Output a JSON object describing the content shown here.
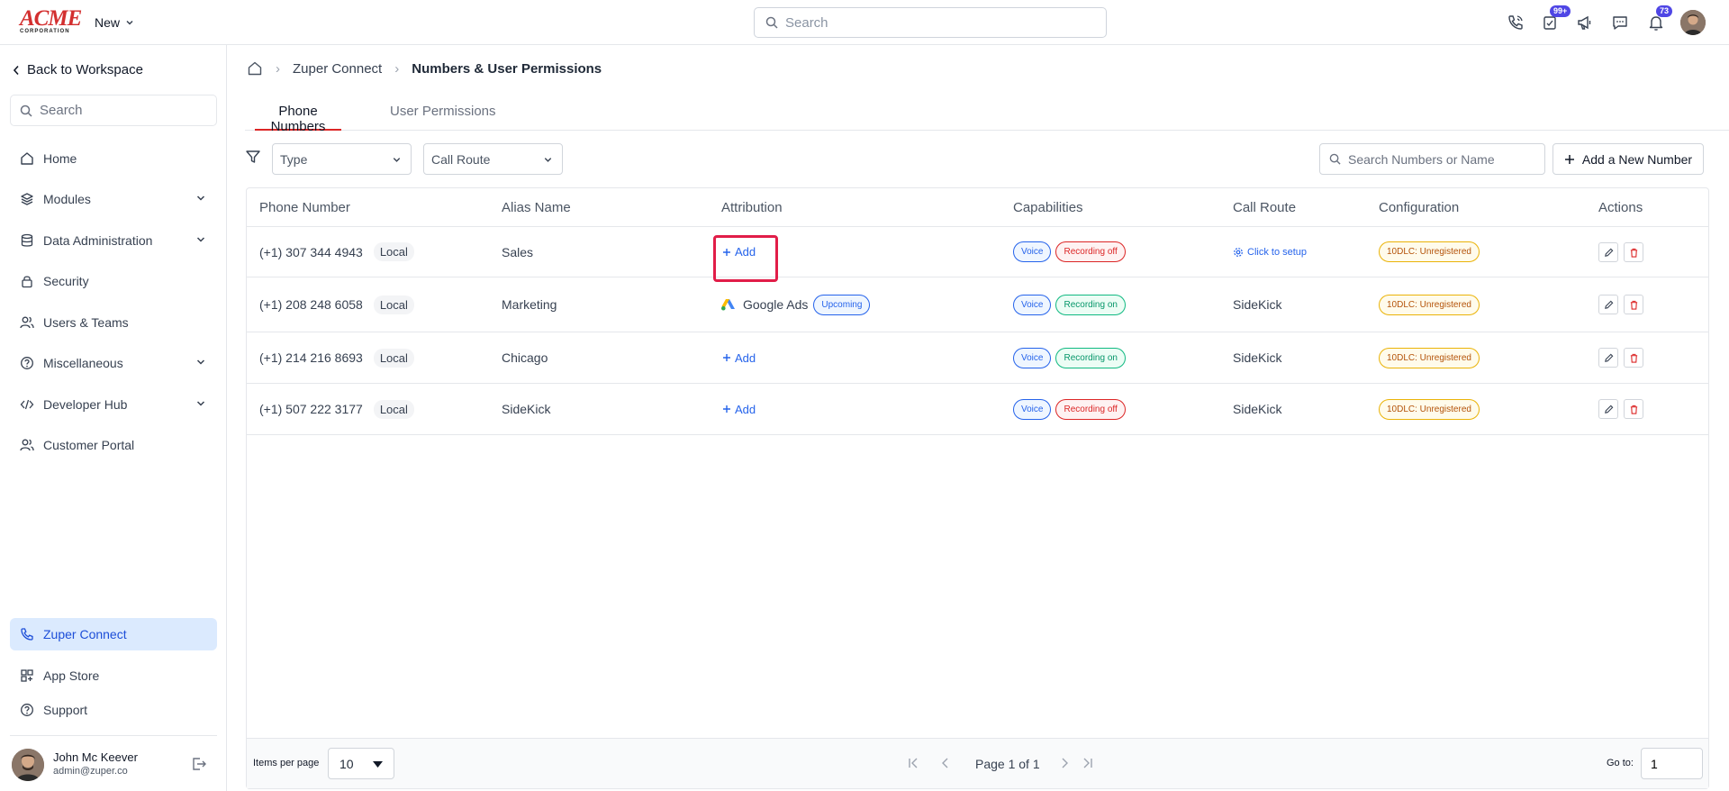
{
  "brand": {
    "logo_main": "ACME",
    "logo_sub": "CORPORATION"
  },
  "topbar": {
    "new_label": "New",
    "search_placeholder": "Search",
    "badges": {
      "tasks": "99+",
      "notifications": "73"
    }
  },
  "sidebar": {
    "back_label": "Back to Workspace",
    "search_placeholder": "Search",
    "items": [
      {
        "label": "Home",
        "icon": "home-icon"
      },
      {
        "label": "Modules",
        "icon": "layers-icon"
      },
      {
        "label": "Data Administration",
        "icon": "database-icon"
      },
      {
        "label": "Security",
        "icon": "lock-icon"
      },
      {
        "label": "Users & Teams",
        "icon": "users-icon"
      },
      {
        "label": "Miscellaneous",
        "icon": "help-circle-icon"
      },
      {
        "label": "Developer Hub",
        "icon": "code-icon"
      },
      {
        "label": "Customer Portal",
        "icon": "users-icon"
      }
    ],
    "bottom_items": [
      {
        "label": "Zuper Connect",
        "icon": "phone-icon"
      },
      {
        "label": "App Store",
        "icon": "grid-plus-icon"
      },
      {
        "label": "Support",
        "icon": "help-circle-icon"
      }
    ],
    "user": {
      "name": "John Mc Keever",
      "email": "admin@zuper.co"
    }
  },
  "breadcrumb": {
    "parent": "Zuper Connect",
    "current": "Numbers & User Permissions"
  },
  "tabs": {
    "phone_numbers": "Phone Numbers",
    "user_permissions": "User Permissions"
  },
  "filters": {
    "type_placeholder": "Type",
    "call_route_placeholder": "Call Route",
    "search_placeholder": "Search Numbers or Name",
    "add_button": "Add a New Number"
  },
  "table": {
    "headers": {
      "phone": "Phone Number",
      "alias": "Alias Name",
      "attribution": "Attribution",
      "capabilities": "Capabilities",
      "call_route": "Call Route",
      "configuration": "Configuration",
      "actions": "Actions"
    },
    "rows": [
      {
        "phone": "(+1) 307 344 4943",
        "type": "Local",
        "alias": "Sales",
        "add": "Add",
        "voice": "Voice",
        "recording": "Recording off",
        "route": "Click to setup",
        "config": "10DLC: Unregistered"
      },
      {
        "phone": "(+1) 208 248 6058",
        "type": "Local",
        "alias": "Marketing",
        "source": "Google Ads",
        "status": "Upcoming",
        "voice": "Voice",
        "recording": "Recording on",
        "route": "SideKick",
        "config": "10DLC: Unregistered"
      },
      {
        "phone": "(+1) 214 216 8693",
        "type": "Local",
        "alias": "Chicago",
        "add": "Add",
        "voice": "Voice",
        "recording": "Recording on",
        "route": "SideKick",
        "config": "10DLC: Unregistered"
      },
      {
        "phone": "(+1) 507 222 3177",
        "type": "Local",
        "alias": "SideKick",
        "add": "Add",
        "voice": "Voice",
        "recording": "Recording off",
        "route": "SideKick",
        "config": "10DLC: Unregistered"
      }
    ]
  },
  "pagination": {
    "items_per_page_label": "Items per page",
    "items_per_page": "10",
    "page_label": "Page 1 of 1",
    "goto_label": "Go to:",
    "goto_value": "1"
  },
  "colors": {
    "accent": "#2563eb",
    "danger": "#dc2626",
    "active_bg": "#dbeafe",
    "highlight": "#e11d48"
  }
}
